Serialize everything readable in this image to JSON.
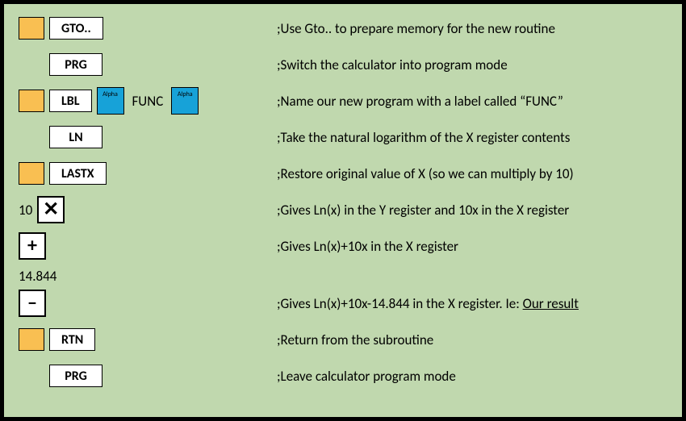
{
  "keys": {
    "gto": "GTO..",
    "prg": "PRG",
    "lbl": "LBL",
    "alpha": "Alpha",
    "func": "FUNC",
    "ln": "LN",
    "lastx": "LASTX",
    "ten": "10",
    "mult": "✕",
    "plus": "+",
    "const": "14.844",
    "minus": "‒",
    "rtn": "RTN"
  },
  "comments": {
    "r1": ";Use Gto.. to prepare memory for the new routine",
    "r2": ";Switch the calculator into program mode",
    "r3": ";Name our new program with a label called “FUNC”",
    "r4": ";Take the natural logarithm of the X register contents",
    "r5": ";Restore original value of X (so we can multiply by 10)",
    "r6": ";Gives Ln(x) in the Y register and 10x in the X register",
    "r7": ";Gives Ln(x)+10x in the X register",
    "r8a": ";Gives Ln(x)+10x-14.844 in the X register. Ie: ",
    "r8b": "Our result",
    "r9": ";Return from the subroutine",
    "r10": ";Leave calculator program mode"
  }
}
